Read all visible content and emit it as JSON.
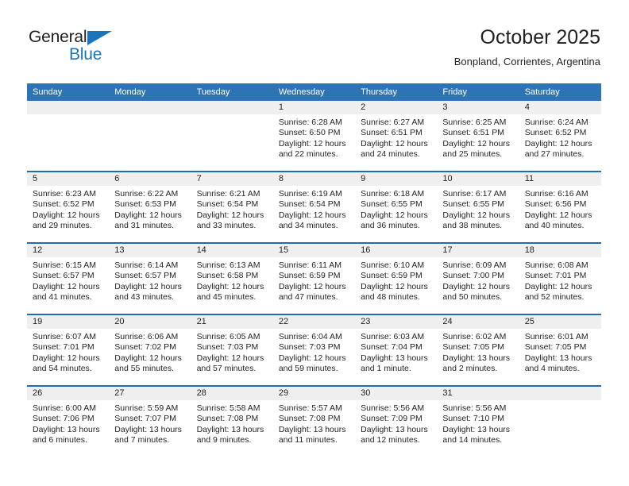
{
  "brand": {
    "name_part1": "General",
    "name_part2": "Blue",
    "triangle_icon": "triangle-icon",
    "accent_color": "#1b75bb"
  },
  "header": {
    "title": "October 2025",
    "subtitle": "Bonpland, Corrientes, Argentina"
  },
  "theme": {
    "header_blue": "#2e74b5",
    "week_divider_blue": "#1f6cb0",
    "daynum_band": "#efefef",
    "text": "#231f20"
  },
  "calendar": {
    "weekday_headers": [
      "Sunday",
      "Monday",
      "Tuesday",
      "Wednesday",
      "Thursday",
      "Friday",
      "Saturday"
    ],
    "weeks": [
      [
        {
          "day": "",
          "blank": true,
          "sunrise": "",
          "sunset": "",
          "daylight1": "",
          "daylight2": ""
        },
        {
          "day": "",
          "blank": true,
          "sunrise": "",
          "sunset": "",
          "daylight1": "",
          "daylight2": ""
        },
        {
          "day": "",
          "blank": true,
          "sunrise": "",
          "sunset": "",
          "daylight1": "",
          "daylight2": ""
        },
        {
          "day": "1",
          "sunrise": "Sunrise: 6:28 AM",
          "sunset": "Sunset: 6:50 PM",
          "daylight1": "Daylight: 12 hours",
          "daylight2": "and 22 minutes."
        },
        {
          "day": "2",
          "sunrise": "Sunrise: 6:27 AM",
          "sunset": "Sunset: 6:51 PM",
          "daylight1": "Daylight: 12 hours",
          "daylight2": "and 24 minutes."
        },
        {
          "day": "3",
          "sunrise": "Sunrise: 6:25 AM",
          "sunset": "Sunset: 6:51 PM",
          "daylight1": "Daylight: 12 hours",
          "daylight2": "and 25 minutes."
        },
        {
          "day": "4",
          "sunrise": "Sunrise: 6:24 AM",
          "sunset": "Sunset: 6:52 PM",
          "daylight1": "Daylight: 12 hours",
          "daylight2": "and 27 minutes."
        }
      ],
      [
        {
          "day": "5",
          "sunrise": "Sunrise: 6:23 AM",
          "sunset": "Sunset: 6:52 PM",
          "daylight1": "Daylight: 12 hours",
          "daylight2": "and 29 minutes."
        },
        {
          "day": "6",
          "sunrise": "Sunrise: 6:22 AM",
          "sunset": "Sunset: 6:53 PM",
          "daylight1": "Daylight: 12 hours",
          "daylight2": "and 31 minutes."
        },
        {
          "day": "7",
          "sunrise": "Sunrise: 6:21 AM",
          "sunset": "Sunset: 6:54 PM",
          "daylight1": "Daylight: 12 hours",
          "daylight2": "and 33 minutes."
        },
        {
          "day": "8",
          "sunrise": "Sunrise: 6:19 AM",
          "sunset": "Sunset: 6:54 PM",
          "daylight1": "Daylight: 12 hours",
          "daylight2": "and 34 minutes."
        },
        {
          "day": "9",
          "sunrise": "Sunrise: 6:18 AM",
          "sunset": "Sunset: 6:55 PM",
          "daylight1": "Daylight: 12 hours",
          "daylight2": "and 36 minutes."
        },
        {
          "day": "10",
          "sunrise": "Sunrise: 6:17 AM",
          "sunset": "Sunset: 6:55 PM",
          "daylight1": "Daylight: 12 hours",
          "daylight2": "and 38 minutes."
        },
        {
          "day": "11",
          "sunrise": "Sunrise: 6:16 AM",
          "sunset": "Sunset: 6:56 PM",
          "daylight1": "Daylight: 12 hours",
          "daylight2": "and 40 minutes."
        }
      ],
      [
        {
          "day": "12",
          "sunrise": "Sunrise: 6:15 AM",
          "sunset": "Sunset: 6:57 PM",
          "daylight1": "Daylight: 12 hours",
          "daylight2": "and 41 minutes."
        },
        {
          "day": "13",
          "sunrise": "Sunrise: 6:14 AM",
          "sunset": "Sunset: 6:57 PM",
          "daylight1": "Daylight: 12 hours",
          "daylight2": "and 43 minutes."
        },
        {
          "day": "14",
          "sunrise": "Sunrise: 6:13 AM",
          "sunset": "Sunset: 6:58 PM",
          "daylight1": "Daylight: 12 hours",
          "daylight2": "and 45 minutes."
        },
        {
          "day": "15",
          "sunrise": "Sunrise: 6:11 AM",
          "sunset": "Sunset: 6:59 PM",
          "daylight1": "Daylight: 12 hours",
          "daylight2": "and 47 minutes."
        },
        {
          "day": "16",
          "sunrise": "Sunrise: 6:10 AM",
          "sunset": "Sunset: 6:59 PM",
          "daylight1": "Daylight: 12 hours",
          "daylight2": "and 48 minutes."
        },
        {
          "day": "17",
          "sunrise": "Sunrise: 6:09 AM",
          "sunset": "Sunset: 7:00 PM",
          "daylight1": "Daylight: 12 hours",
          "daylight2": "and 50 minutes."
        },
        {
          "day": "18",
          "sunrise": "Sunrise: 6:08 AM",
          "sunset": "Sunset: 7:01 PM",
          "daylight1": "Daylight: 12 hours",
          "daylight2": "and 52 minutes."
        }
      ],
      [
        {
          "day": "19",
          "sunrise": "Sunrise: 6:07 AM",
          "sunset": "Sunset: 7:01 PM",
          "daylight1": "Daylight: 12 hours",
          "daylight2": "and 54 minutes."
        },
        {
          "day": "20",
          "sunrise": "Sunrise: 6:06 AM",
          "sunset": "Sunset: 7:02 PM",
          "daylight1": "Daylight: 12 hours",
          "daylight2": "and 55 minutes."
        },
        {
          "day": "21",
          "sunrise": "Sunrise: 6:05 AM",
          "sunset": "Sunset: 7:03 PM",
          "daylight1": "Daylight: 12 hours",
          "daylight2": "and 57 minutes."
        },
        {
          "day": "22",
          "sunrise": "Sunrise: 6:04 AM",
          "sunset": "Sunset: 7:03 PM",
          "daylight1": "Daylight: 12 hours",
          "daylight2": "and 59 minutes."
        },
        {
          "day": "23",
          "sunrise": "Sunrise: 6:03 AM",
          "sunset": "Sunset: 7:04 PM",
          "daylight1": "Daylight: 13 hours",
          "daylight2": "and 1 minute."
        },
        {
          "day": "24",
          "sunrise": "Sunrise: 6:02 AM",
          "sunset": "Sunset: 7:05 PM",
          "daylight1": "Daylight: 13 hours",
          "daylight2": "and 2 minutes."
        },
        {
          "day": "25",
          "sunrise": "Sunrise: 6:01 AM",
          "sunset": "Sunset: 7:05 PM",
          "daylight1": "Daylight: 13 hours",
          "daylight2": "and 4 minutes."
        }
      ],
      [
        {
          "day": "26",
          "sunrise": "Sunrise: 6:00 AM",
          "sunset": "Sunset: 7:06 PM",
          "daylight1": "Daylight: 13 hours",
          "daylight2": "and 6 minutes."
        },
        {
          "day": "27",
          "sunrise": "Sunrise: 5:59 AM",
          "sunset": "Sunset: 7:07 PM",
          "daylight1": "Daylight: 13 hours",
          "daylight2": "and 7 minutes."
        },
        {
          "day": "28",
          "sunrise": "Sunrise: 5:58 AM",
          "sunset": "Sunset: 7:08 PM",
          "daylight1": "Daylight: 13 hours",
          "daylight2": "and 9 minutes."
        },
        {
          "day": "29",
          "sunrise": "Sunrise: 5:57 AM",
          "sunset": "Sunset: 7:08 PM",
          "daylight1": "Daylight: 13 hours",
          "daylight2": "and 11 minutes."
        },
        {
          "day": "30",
          "sunrise": "Sunrise: 5:56 AM",
          "sunset": "Sunset: 7:09 PM",
          "daylight1": "Daylight: 13 hours",
          "daylight2": "and 12 minutes."
        },
        {
          "day": "31",
          "sunrise": "Sunrise: 5:56 AM",
          "sunset": "Sunset: 7:10 PM",
          "daylight1": "Daylight: 13 hours",
          "daylight2": "and 14 minutes."
        },
        {
          "day": "",
          "blank": true,
          "sunrise": "",
          "sunset": "",
          "daylight1": "",
          "daylight2": ""
        }
      ]
    ]
  }
}
